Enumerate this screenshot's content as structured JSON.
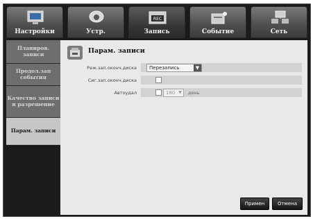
{
  "tabs": [
    {
      "label": "Настройки",
      "icon": "monitor-icon"
    },
    {
      "label": "Устр.",
      "icon": "camera-icon"
    },
    {
      "label": "Запись",
      "icon": "rec-icon"
    },
    {
      "label": "Событие",
      "icon": "event-icon"
    },
    {
      "label": "Сеть",
      "icon": "network-icon"
    }
  ],
  "sidebar": {
    "items": [
      {
        "label": "Планиров. записи"
      },
      {
        "label": "Продол.зап события"
      },
      {
        "label": "Качество записи и разрешение"
      },
      {
        "label": "Парам. записи"
      }
    ]
  },
  "main": {
    "title": "Парам. записи",
    "fields": {
      "disk_end_mode_label": "Реж.зап.оконч.диска",
      "disk_end_mode_value": "Перезапись",
      "disk_end_beep_label": "Сиг.зап.оконч.диска",
      "auto_delete_label": "Автоудал",
      "auto_delete_days": "180",
      "auto_delete_unit": "день"
    },
    "buttons": {
      "apply": "Примен",
      "cancel": "Отмена"
    }
  },
  "colors": {
    "frame": "#1b1b1b",
    "tab": "#5a5a5a",
    "panel": "#e9e9e9",
    "sidebar_active": "#c6c6c6"
  }
}
